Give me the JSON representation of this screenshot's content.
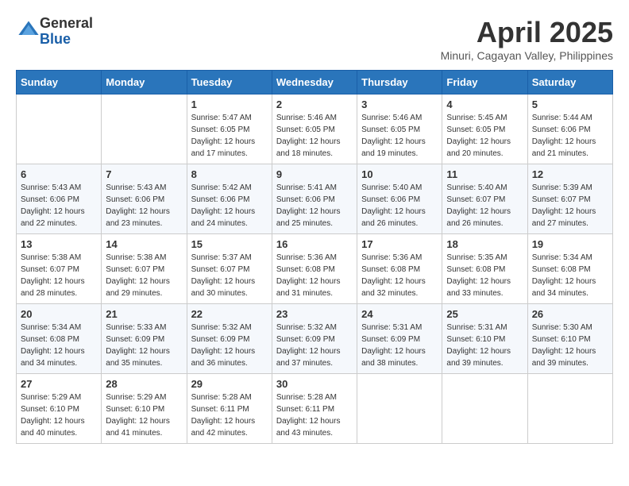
{
  "logo": {
    "general": "General",
    "blue": "Blue"
  },
  "title": "April 2025",
  "subtitle": "Minuri, Cagayan Valley, Philippines",
  "days_of_week": [
    "Sunday",
    "Monday",
    "Tuesday",
    "Wednesday",
    "Thursday",
    "Friday",
    "Saturday"
  ],
  "weeks": [
    [
      null,
      null,
      {
        "day": "1",
        "sunrise": "5:47 AM",
        "sunset": "6:05 PM",
        "daylight": "12 hours and 17 minutes."
      },
      {
        "day": "2",
        "sunrise": "5:46 AM",
        "sunset": "6:05 PM",
        "daylight": "12 hours and 18 minutes."
      },
      {
        "day": "3",
        "sunrise": "5:46 AM",
        "sunset": "6:05 PM",
        "daylight": "12 hours and 19 minutes."
      },
      {
        "day": "4",
        "sunrise": "5:45 AM",
        "sunset": "6:05 PM",
        "daylight": "12 hours and 20 minutes."
      },
      {
        "day": "5",
        "sunrise": "5:44 AM",
        "sunset": "6:06 PM",
        "daylight": "12 hours and 21 minutes."
      }
    ],
    [
      {
        "day": "6",
        "sunrise": "5:43 AM",
        "sunset": "6:06 PM",
        "daylight": "12 hours and 22 minutes."
      },
      {
        "day": "7",
        "sunrise": "5:43 AM",
        "sunset": "6:06 PM",
        "daylight": "12 hours and 23 minutes."
      },
      {
        "day": "8",
        "sunrise": "5:42 AM",
        "sunset": "6:06 PM",
        "daylight": "12 hours and 24 minutes."
      },
      {
        "day": "9",
        "sunrise": "5:41 AM",
        "sunset": "6:06 PM",
        "daylight": "12 hours and 25 minutes."
      },
      {
        "day": "10",
        "sunrise": "5:40 AM",
        "sunset": "6:06 PM",
        "daylight": "12 hours and 26 minutes."
      },
      {
        "day": "11",
        "sunrise": "5:40 AM",
        "sunset": "6:07 PM",
        "daylight": "12 hours and 26 minutes."
      },
      {
        "day": "12",
        "sunrise": "5:39 AM",
        "sunset": "6:07 PM",
        "daylight": "12 hours and 27 minutes."
      }
    ],
    [
      {
        "day": "13",
        "sunrise": "5:38 AM",
        "sunset": "6:07 PM",
        "daylight": "12 hours and 28 minutes."
      },
      {
        "day": "14",
        "sunrise": "5:38 AM",
        "sunset": "6:07 PM",
        "daylight": "12 hours and 29 minutes."
      },
      {
        "day": "15",
        "sunrise": "5:37 AM",
        "sunset": "6:07 PM",
        "daylight": "12 hours and 30 minutes."
      },
      {
        "day": "16",
        "sunrise": "5:36 AM",
        "sunset": "6:08 PM",
        "daylight": "12 hours and 31 minutes."
      },
      {
        "day": "17",
        "sunrise": "5:36 AM",
        "sunset": "6:08 PM",
        "daylight": "12 hours and 32 minutes."
      },
      {
        "day": "18",
        "sunrise": "5:35 AM",
        "sunset": "6:08 PM",
        "daylight": "12 hours and 33 minutes."
      },
      {
        "day": "19",
        "sunrise": "5:34 AM",
        "sunset": "6:08 PM",
        "daylight": "12 hours and 34 minutes."
      }
    ],
    [
      {
        "day": "20",
        "sunrise": "5:34 AM",
        "sunset": "6:08 PM",
        "daylight": "12 hours and 34 minutes."
      },
      {
        "day": "21",
        "sunrise": "5:33 AM",
        "sunset": "6:09 PM",
        "daylight": "12 hours and 35 minutes."
      },
      {
        "day": "22",
        "sunrise": "5:32 AM",
        "sunset": "6:09 PM",
        "daylight": "12 hours and 36 minutes."
      },
      {
        "day": "23",
        "sunrise": "5:32 AM",
        "sunset": "6:09 PM",
        "daylight": "12 hours and 37 minutes."
      },
      {
        "day": "24",
        "sunrise": "5:31 AM",
        "sunset": "6:09 PM",
        "daylight": "12 hours and 38 minutes."
      },
      {
        "day": "25",
        "sunrise": "5:31 AM",
        "sunset": "6:10 PM",
        "daylight": "12 hours and 39 minutes."
      },
      {
        "day": "26",
        "sunrise": "5:30 AM",
        "sunset": "6:10 PM",
        "daylight": "12 hours and 39 minutes."
      }
    ],
    [
      {
        "day": "27",
        "sunrise": "5:29 AM",
        "sunset": "6:10 PM",
        "daylight": "12 hours and 40 minutes."
      },
      {
        "day": "28",
        "sunrise": "5:29 AM",
        "sunset": "6:10 PM",
        "daylight": "12 hours and 41 minutes."
      },
      {
        "day": "29",
        "sunrise": "5:28 AM",
        "sunset": "6:11 PM",
        "daylight": "12 hours and 42 minutes."
      },
      {
        "day": "30",
        "sunrise": "5:28 AM",
        "sunset": "6:11 PM",
        "daylight": "12 hours and 43 minutes."
      },
      null,
      null,
      null
    ]
  ],
  "labels": {
    "sunrise": "Sunrise:",
    "sunset": "Sunset:",
    "daylight": "Daylight:"
  }
}
